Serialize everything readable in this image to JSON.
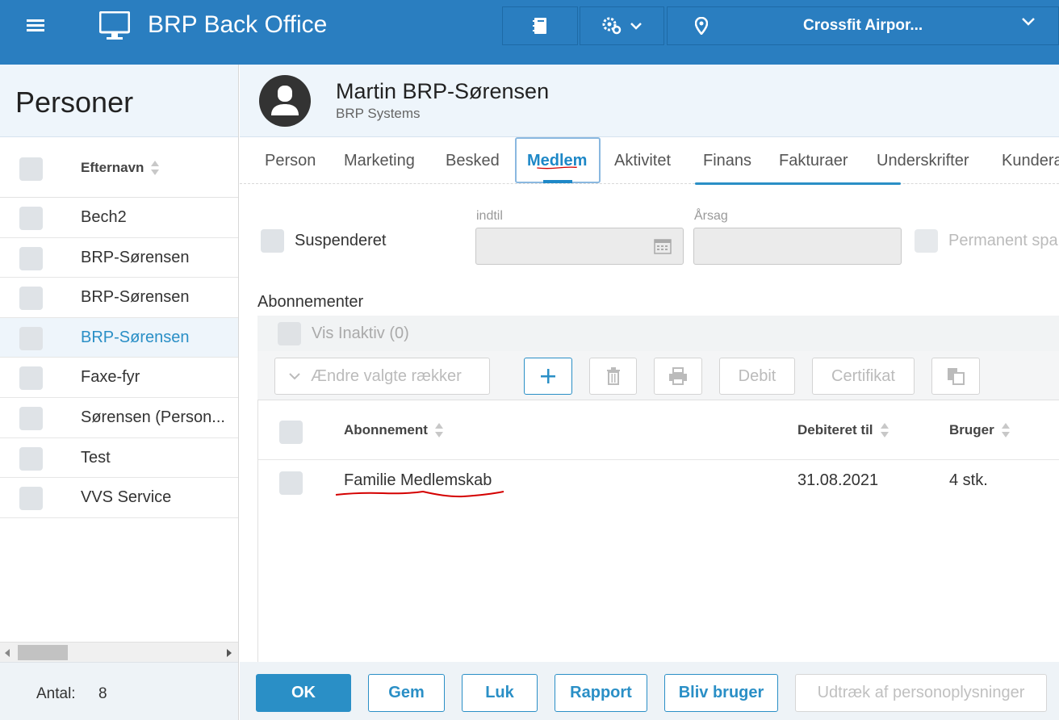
{
  "app": {
    "title": "BRP Back Office",
    "location": "Crossfit Airpor..."
  },
  "left": {
    "title": "Personer",
    "column": "Efternavn",
    "rows": [
      "Bech2",
      "BRP-Sørensen",
      "BRP-Sørensen",
      "BRP-Sørensen",
      "Faxe-fyr",
      "Sørensen (Person...",
      "Test",
      "VVS Service"
    ],
    "active_index": 3,
    "count_label": "Antal:",
    "count": "8"
  },
  "person": {
    "name": "Martin BRP-Sørensen",
    "org": "BRP Systems"
  },
  "tabs": [
    "Person",
    "Marketing",
    "Besked",
    "Medlem",
    "Aktivitet",
    "Finans",
    "Fakturaer",
    "Underskrifter",
    "Kundera"
  ],
  "active_tab": "Medlem",
  "suspension": {
    "label": "Suspenderet",
    "until_label": "indtil",
    "reason_label": "Årsag",
    "permanent_label": "Permanent spa"
  },
  "subscriptions": {
    "title": "Abonnementer",
    "show_inactive": "Vis Inaktiv (0)",
    "bulk_edit": "Ændre valgte rækker",
    "debit": "Debit",
    "certificate": "Certifikat",
    "columns": {
      "name": "Abonnement",
      "billed_until": "Debiteret til",
      "users": "Bruger"
    },
    "rows": [
      {
        "name": "Familie Medlemskab",
        "billed_until": "31.08.2021",
        "users": "4 stk."
      }
    ]
  },
  "footer": {
    "ok": "OK",
    "save": "Gem",
    "close": "Luk",
    "report": "Rapport",
    "become_user": "Bliv bruger",
    "export": "Udtræk af personoplysninger"
  },
  "colors": {
    "topbar": "#2a7ec0",
    "accent": "#2a8fc6",
    "annotation": "#d40000"
  }
}
